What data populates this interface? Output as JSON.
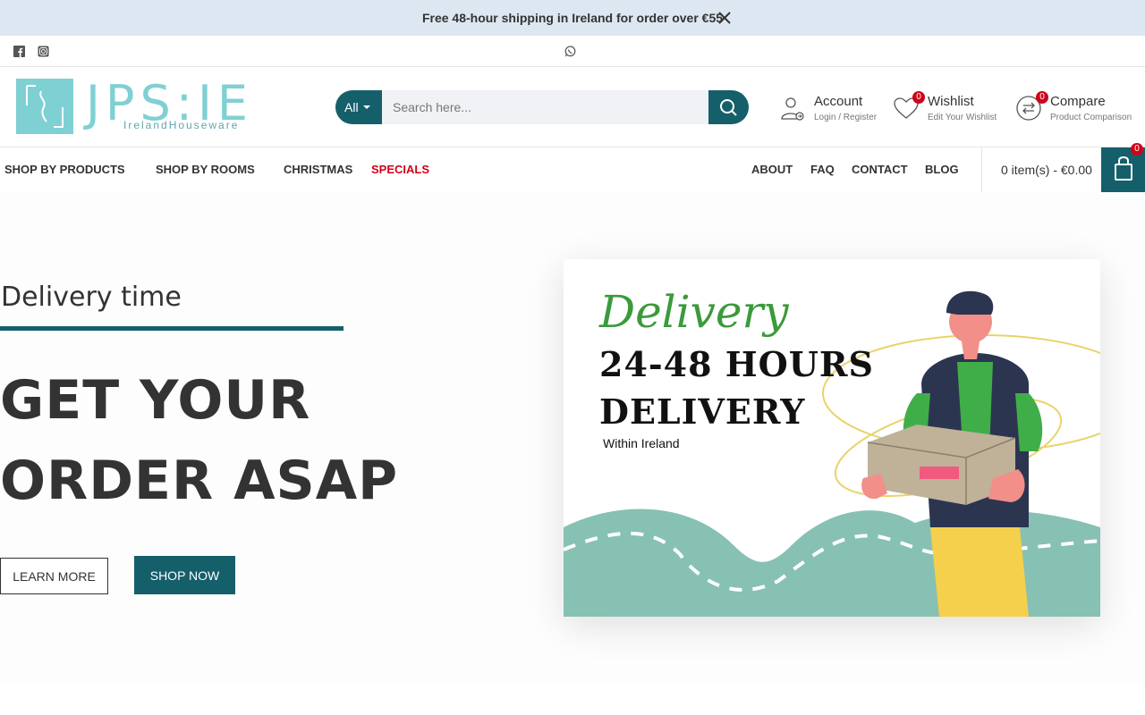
{
  "announcement": {
    "text": "Free 48-hour shipping in Ireland for order over €55"
  },
  "social": {
    "icons": [
      "facebook-icon",
      "instagram-icon",
      "whatsapp-icon"
    ]
  },
  "logo": {
    "main": "JPS:IE",
    "sub": "IrelandHouseware"
  },
  "search": {
    "category": "All",
    "placeholder": "Search here..."
  },
  "header_links": {
    "account": {
      "title": "Account",
      "sub": "Login / Register"
    },
    "wishlist": {
      "title": "Wishlist",
      "sub": "Edit Your Wishlist",
      "count": "0"
    },
    "compare": {
      "title": "Compare",
      "sub": "Product Comparison",
      "count": "0"
    }
  },
  "nav": {
    "left": [
      "SHOP BY PRODUCTS",
      "SHOP BY ROOMS",
      "CHRISTMAS",
      "SPECIALS"
    ],
    "right": [
      "ABOUT",
      "FAQ",
      "CONTACT",
      "BLOG"
    ],
    "cart_text": "0 item(s) - €0.00",
    "cart_count": "0"
  },
  "hero": {
    "eyebrow": "Delivery time",
    "title_line1": "GET YOUR",
    "title_line2": "ORDER ASAP",
    "learn_more": "LEARN MORE",
    "shop_now": "SHOP NOW"
  },
  "promo": {
    "script": "Delivery",
    "line1": "24-48 HOURS",
    "line2": "DELIVERY",
    "sub": "Within Ireland"
  },
  "colors": {
    "brand": "#155f6b",
    "accent_red": "#d0021b",
    "announce_bg": "#dce7f1",
    "logo_teal": "#7fd0d3"
  }
}
